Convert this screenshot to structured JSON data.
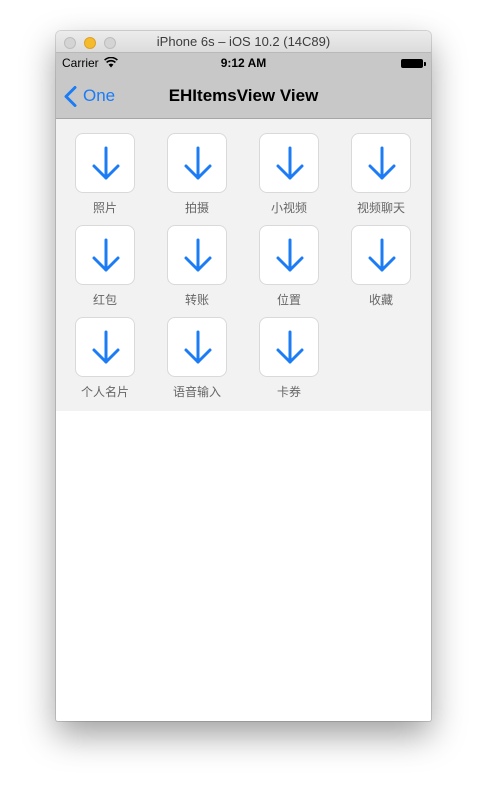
{
  "window": {
    "title": "iPhone 6s – iOS 10.2 (14C89)"
  },
  "status_bar": {
    "carrier": "Carrier",
    "time": "9:12 AM"
  },
  "nav_bar": {
    "back_label": "One",
    "title": "EHItemsView View"
  },
  "colors": {
    "accent": "#1b7cf6",
    "panel": "#f2f2f2",
    "navbar": "#c8c8c8",
    "label": "#666666"
  },
  "items": [
    {
      "label": "照片",
      "icon": "down-arrow-icon"
    },
    {
      "label": "拍摄",
      "icon": "down-arrow-icon"
    },
    {
      "label": "小视频",
      "icon": "down-arrow-icon"
    },
    {
      "label": "视频聊天",
      "icon": "down-arrow-icon"
    },
    {
      "label": "红包",
      "icon": "down-arrow-icon"
    },
    {
      "label": "转账",
      "icon": "down-arrow-icon"
    },
    {
      "label": "位置",
      "icon": "down-arrow-icon"
    },
    {
      "label": "收藏",
      "icon": "down-arrow-icon"
    },
    {
      "label": "个人名片",
      "icon": "down-arrow-icon"
    },
    {
      "label": "语音输入",
      "icon": "down-arrow-icon"
    },
    {
      "label": "卡券",
      "icon": "down-arrow-icon"
    }
  ]
}
